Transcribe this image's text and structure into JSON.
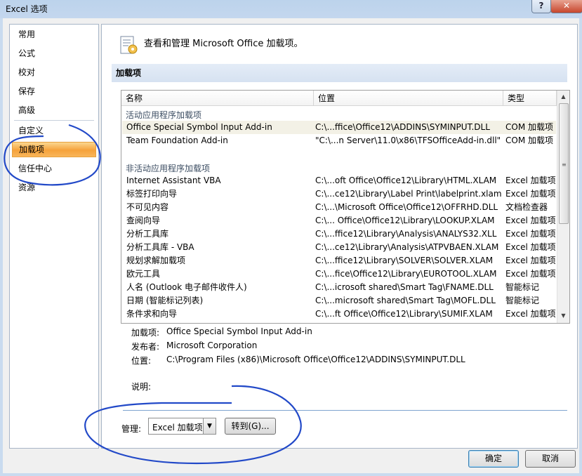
{
  "window": {
    "title": "Excel 选项",
    "help_label": "?",
    "close_label": "✕"
  },
  "nav": {
    "items": [
      {
        "label": "常用"
      },
      {
        "label": "公式"
      },
      {
        "label": "校对"
      },
      {
        "label": "保存"
      },
      {
        "label": "高级"
      },
      {
        "label": "自定义"
      },
      {
        "label": "加载项",
        "selected": true
      },
      {
        "label": "信任中心"
      },
      {
        "label": "资源"
      }
    ]
  },
  "header": {
    "title": "查看和管理 Microsoft Office 加载项。",
    "icon": "addins-settings-icon"
  },
  "section": {
    "title": "加载项"
  },
  "table": {
    "columns": [
      "名称",
      "位置",
      "类型"
    ],
    "groups": [
      {
        "title": "活动应用程序加载项",
        "rows": [
          [
            "Office Special Symbol Input Add-in",
            "C:\\...ffice\\Office12\\ADDINS\\SYMINPUT.DLL",
            "COM 加载项"
          ],
          [
            "Team Foundation Add-in",
            "\"C:\\...n Server\\11.0\\x86\\TFSOfficeAdd-in.dll\"",
            "COM 加载项"
          ]
        ]
      },
      {
        "title": "非活动应用程序加载项",
        "rows": [
          [
            "Internet Assistant VBA",
            "C:\\...oft Office\\Office12\\Library\\HTML.XLAM",
            "Excel 加载项"
          ],
          [
            "标签打印向导",
            "C:\\...ce12\\Library\\Label Print\\labelprint.xlam",
            "Excel 加载项"
          ],
          [
            "不可见内容",
            "C:\\...\\Microsoft Office\\Office12\\OFFRHD.DLL",
            "文档检查器"
          ],
          [
            "查阅向导",
            "C:\\... Office\\Office12\\Library\\LOOKUP.XLAM",
            "Excel 加载项"
          ],
          [
            "分析工具库",
            "C:\\...ffice12\\Library\\Analysis\\ANALYS32.XLL",
            "Excel 加载项"
          ],
          [
            "分析工具库 - VBA",
            "C:\\...ce12\\Library\\Analysis\\ATPVBAEN.XLAM",
            "Excel 加载项"
          ],
          [
            "规划求解加载项",
            "C:\\...ffice12\\Library\\SOLVER\\SOLVER.XLAM",
            "Excel 加载项"
          ],
          [
            "欧元工具",
            "C:\\...fice\\Office12\\Library\\EUROTOOL.XLAM",
            "Excel 加载项"
          ],
          [
            "人名 (Outlook 电子邮件收件人)",
            "C:\\...icrosoft shared\\Smart Tag\\FNAME.DLL",
            "智能标记"
          ],
          [
            "日期 (智能标记列表)",
            "C:\\...microsoft shared\\Smart Tag\\MOFL.DLL",
            "智能标记"
          ],
          [
            "条件求和向导",
            "C:\\...ft Office\\Office12\\Library\\SUMIF.XLAM",
            "Excel 加载项"
          ]
        ]
      }
    ]
  },
  "details": {
    "addin_label": "加载项:",
    "addin_value": "Office Special Symbol Input Add-in",
    "publisher_label": "发布者:",
    "publisher_value": "Microsoft Corporation",
    "location_label": "位置:",
    "location_value": "C:\\Program Files (x86)\\Microsoft Office\\Office12\\ADDINS\\SYMINPUT.DLL",
    "description_label": "说明:"
  },
  "manage": {
    "label": "管理:",
    "selected": "Excel 加载项",
    "goto_label": "转到(G)..."
  },
  "footer": {
    "ok_label": "确定",
    "cancel_label": "取消"
  },
  "colors": {
    "selection_orange": "#f6a23b",
    "annotation_blue": "#2249c8"
  }
}
